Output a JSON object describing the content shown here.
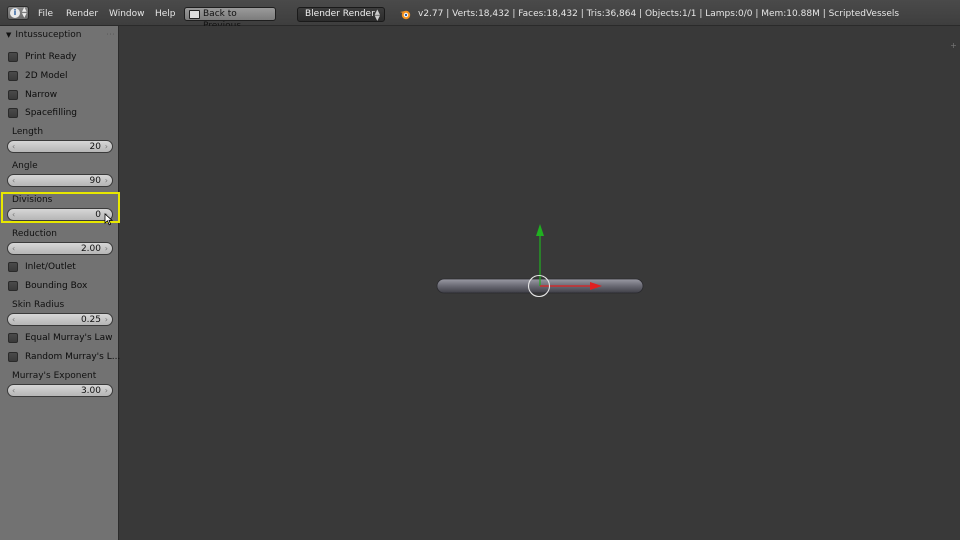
{
  "header": {
    "editor_type_icon": "info-icon",
    "menus": [
      "File",
      "Render",
      "Window",
      "Help"
    ],
    "back_button": "Back to Previous",
    "render_engine": "Blender Render",
    "stats": "v2.77 | Verts:18,432 | Faces:18,432 | Tris:36,864 | Objects:1/1 | Lamps:0/0 | Mem:10.88M | ScriptedVessels"
  },
  "panel": {
    "title": "Intussuception",
    "checkboxes_top": [
      {
        "label": "Print Ready",
        "checked": false
      },
      {
        "label": "2D Model",
        "checked": false
      },
      {
        "label": "Narrow",
        "checked": false
      },
      {
        "label": "Spacefilling",
        "checked": false
      }
    ],
    "length": {
      "label": "Length",
      "value": "20"
    },
    "angle": {
      "label": "Angle",
      "value": "90"
    },
    "divisions": {
      "label": "Divisions",
      "value": "0"
    },
    "reduction": {
      "label": "Reduction",
      "value": "2.00"
    },
    "checkboxes_mid": [
      {
        "label": "Inlet/Outlet",
        "checked": false
      },
      {
        "label": "Bounding Box",
        "checked": false
      }
    ],
    "skin_radius": {
      "label": "Skin Radius",
      "value": "0.25"
    },
    "checkboxes_bottom": [
      {
        "label": "Equal Murray's Law",
        "checked": false
      },
      {
        "label": "Random Murray's L...",
        "checked": false
      }
    ],
    "murray_exponent": {
      "label": "Murray's Exponent",
      "value": "3.00"
    }
  },
  "colors": {
    "highlight": "#e8e800",
    "axis_x": "#e02020",
    "axis_y": "#20b020",
    "viewport_bg": "#393939",
    "panel_bg": "#727272"
  }
}
